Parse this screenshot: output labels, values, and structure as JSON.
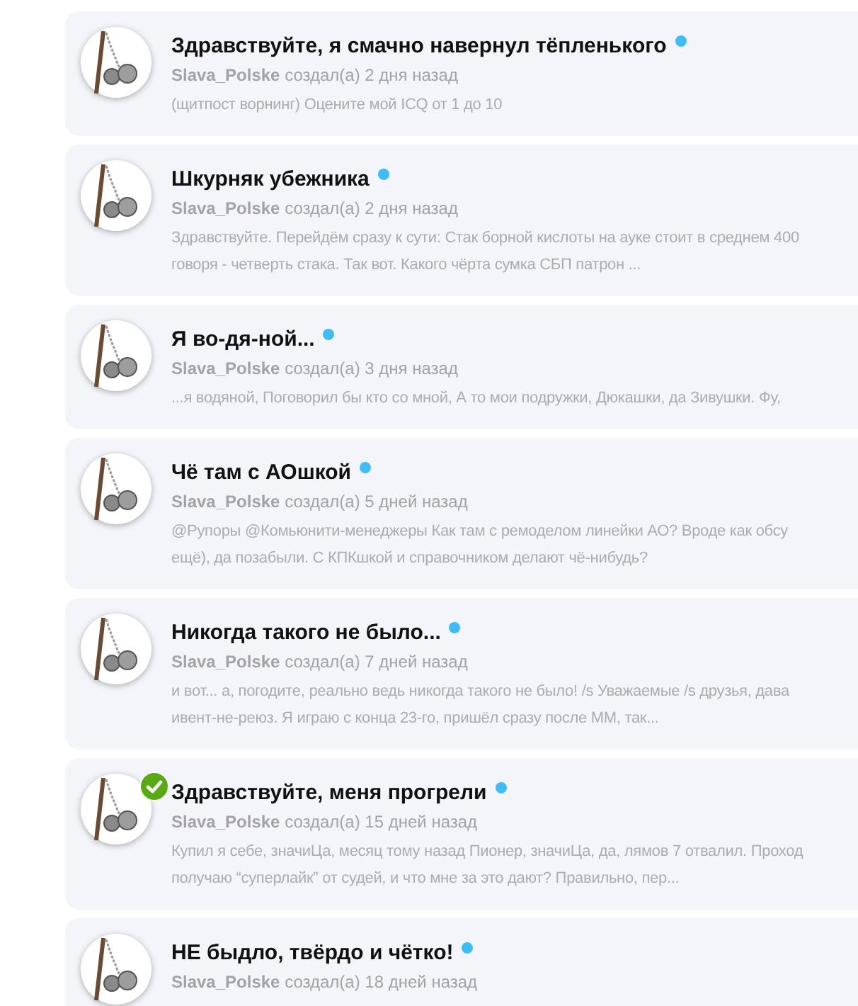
{
  "topics": [
    {
      "title": "Здравствуйте, я смачно навернул тёпленького",
      "unread": true,
      "solved": false,
      "author": "Slava_Polske",
      "meta": "создал(а) 2 дня назад",
      "excerpt": [
        "(щитпост ворнинг) Оцените мой ICQ от 1 до 10"
      ]
    },
    {
      "title": "Шкурняк убежника",
      "unread": true,
      "solved": false,
      "author": "Slava_Polske",
      "meta": "создал(а) 2 дня назад",
      "excerpt": [
        "Здравствуйте. Перейдём сразу к сути: Стак борной кислоты на ауке стоит в среднем 400",
        "говоря - четверть стака. Так вот. Какого чёрта сумка СБП патрон ..."
      ]
    },
    {
      "title": "Я во-дя-ной...",
      "unread": true,
      "solved": false,
      "author": "Slava_Polske",
      "meta": "создал(а) 3 дня назад",
      "excerpt": [
        "...я водяной, Поговорил бы кто со мной, А то мои подружки, Дюкашки, да Зивушки. Фу,"
      ]
    },
    {
      "title": "Чё там с АОшкой",
      "unread": true,
      "solved": false,
      "author": "Slava_Polske",
      "meta": "создал(а) 5 дней назад",
      "excerpt": [
        "@Рупоры @Комьюнити-менеджеры Как там с ремоделом линейки АО? Вроде как обсу",
        "ещё), да позабыли. С КПКшкой и справочником делают чё-нибудь?"
      ]
    },
    {
      "title": "Никогда такого не было...",
      "unread": true,
      "solved": false,
      "author": "Slava_Polske",
      "meta": "создал(а) 7 дней назад",
      "excerpt": [
        "и вот... а, погодите, реально ведь никогда такого не было! /s Уважаемые /s друзья, дава",
        "ивент-не-реюз. Я играю с конца 23-го, пришёл сразу после ММ, так..."
      ]
    },
    {
      "title": "Здравствуйте, меня прогрели",
      "unread": true,
      "solved": true,
      "author": "Slava_Polske",
      "meta": "создал(а) 15 дней назад",
      "excerpt": [
        "Купил я себе, значиЦа, месяц тому назад Пионер, значиЦа, да, лямов 7 отвалил. Проход",
        "получаю “суперлайк” от судей, и что мне за это дают? Правильно, пер..."
      ]
    },
    {
      "title": "НЕ быдло, твёрдо и чётко!",
      "unread": true,
      "solved": false,
      "author": "Slava_Polske",
      "meta": "создал(а) 18 дней назад"
    }
  ]
}
